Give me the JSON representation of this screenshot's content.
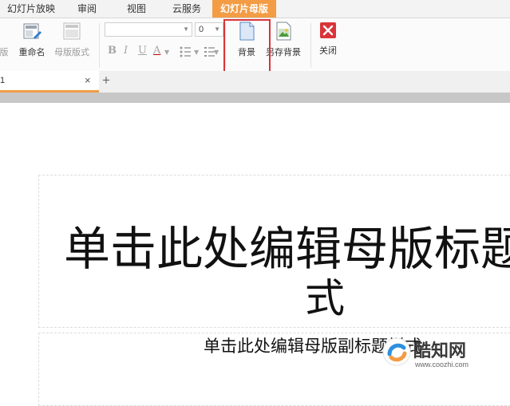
{
  "menu": {
    "tabs": [
      {
        "label": "幻灯片放映",
        "active": false
      },
      {
        "label": "审阅",
        "active": false
      },
      {
        "label": "视图",
        "active": false
      },
      {
        "label": "云服务",
        "active": false
      },
      {
        "label": "幻灯片母版",
        "active": true
      }
    ]
  },
  "ribbon": {
    "partial_label": "版",
    "rename_label": "重命名",
    "layout_label": "母版版式",
    "font_name": "",
    "font_size": "0",
    "bold": "B",
    "italic": "I",
    "underline": "U",
    "font_color": "A",
    "background_label": "背景",
    "save_background_label": "另存背景",
    "close_label": "关闭"
  },
  "doc_tabs": {
    "active_title": "1",
    "close_glyph": "×",
    "new_tab_glyph": "+"
  },
  "slide": {
    "title_line1": "单击此处编辑母版标题",
    "title_line2": "式",
    "subtitle": "单击此处编辑母版副标题样式"
  },
  "watermark": {
    "name": "酷知网",
    "url": "www.coozhi.com"
  },
  "colors": {
    "accent": "#f39c45",
    "highlight": "#d9343a",
    "close_red": "#d9343a"
  }
}
